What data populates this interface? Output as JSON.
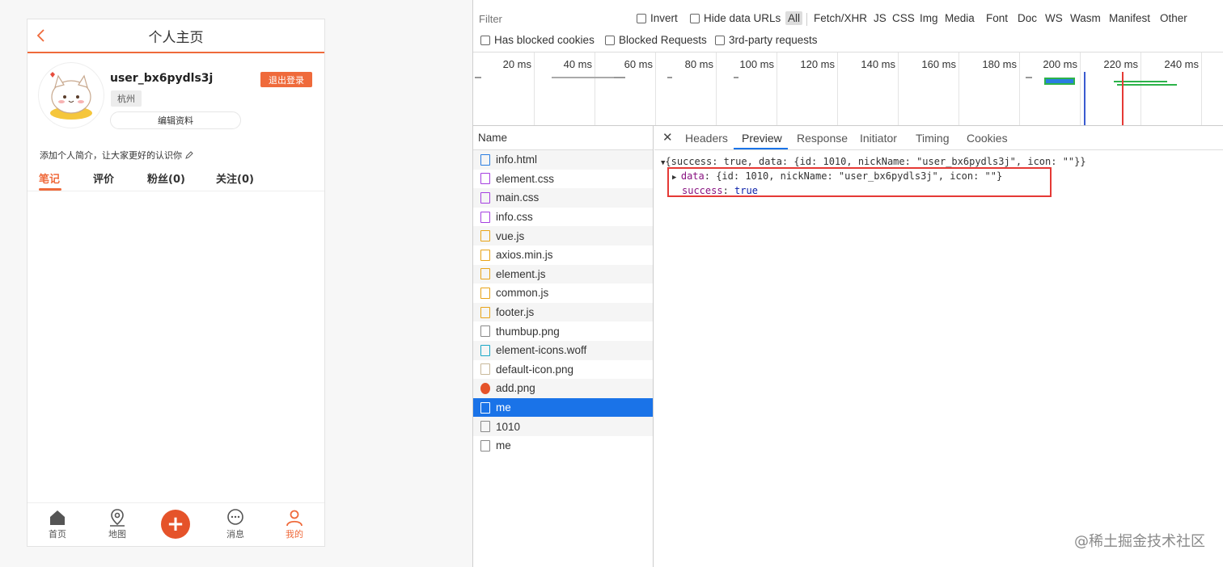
{
  "app": {
    "title": "个人主页",
    "username": "user_bx6pydls3j",
    "city": "杭州",
    "edit_label": "编辑资料",
    "logout_label": "退出登录",
    "intro": "添加个人简介，让大家更好的认识你",
    "tabs": [
      "笔记",
      "评价",
      "粉丝(0)",
      "关注(0)"
    ],
    "nav": [
      "首页",
      "地图",
      "消息",
      "我的"
    ],
    "accent": "#ef6a3b"
  },
  "devtools": {
    "filter_placeholder": "Filter",
    "checks_row1": [
      "Invert",
      "Hide data URLs"
    ],
    "types": [
      "All",
      "Fetch/XHR",
      "JS",
      "CSS",
      "Img",
      "Media",
      "Font",
      "Doc",
      "WS",
      "Wasm",
      "Manifest",
      "Other"
    ],
    "checks_row2": [
      "Has blocked cookies",
      "Blocked Requests",
      "3rd-party requests"
    ],
    "ticks": [
      "20 ms",
      "40 ms",
      "60 ms",
      "80 ms",
      "100 ms",
      "120 ms",
      "140 ms",
      "160 ms",
      "180 ms",
      "200 ms",
      "220 ms",
      "240 ms"
    ],
    "name_header": "Name",
    "files": [
      {
        "name": "info.html",
        "type": "doc"
      },
      {
        "name": "element.css",
        "type": "css"
      },
      {
        "name": "main.css",
        "type": "css"
      },
      {
        "name": "info.css",
        "type": "css"
      },
      {
        "name": "vue.js",
        "type": "js"
      },
      {
        "name": "axios.min.js",
        "type": "js"
      },
      {
        "name": "element.js",
        "type": "js"
      },
      {
        "name": "common.js",
        "type": "js"
      },
      {
        "name": "footer.js",
        "type": "js"
      },
      {
        "name": "thumbup.png",
        "type": "img"
      },
      {
        "name": "element-icons.woff",
        "type": "font"
      },
      {
        "name": "default-icon.png",
        "type": "img"
      },
      {
        "name": "add.png",
        "type": "img"
      },
      {
        "name": "me",
        "type": "xhr"
      },
      {
        "name": "1010",
        "type": "xhr"
      },
      {
        "name": "me",
        "type": "xhr"
      }
    ],
    "selected_index": 13,
    "detail_tabs": [
      "Headers",
      "Preview",
      "Response",
      "Initiator",
      "Timing",
      "Cookies"
    ],
    "active_detail_tab": "Preview",
    "json_summary": "{success: true, data: {id: 1010, nickName: \"user_bx6pydls3j\", icon: \"\"}}",
    "json_data_key": "data",
    "json_data_value": "{id: 1010, nickName: \"user_bx6pydls3j\", icon: \"\"}",
    "json_success_key": "success",
    "json_success_value": "true"
  },
  "watermark": "@稀土掘金技术社区"
}
